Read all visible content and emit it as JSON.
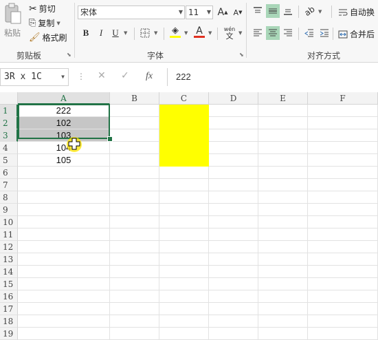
{
  "ribbon": {
    "clipboard": {
      "paste_label": "粘贴",
      "cut_label": "剪切",
      "copy_label": "复制",
      "format_painter_label": "格式刷",
      "group_label": "剪贴板"
    },
    "font": {
      "font_name": "宋体",
      "font_size": "11",
      "increase_label": "A",
      "decrease_label": "A",
      "bold": "B",
      "italic": "I",
      "underline": "U",
      "font_color_label": "A",
      "phonetic_top": "wén",
      "phonetic_bottom": "文",
      "group_label": "字体"
    },
    "alignment": {
      "wrap_label": "自动换",
      "merge_label": "合并后",
      "group_label": "对齐方式"
    }
  },
  "formula_bar": {
    "name_box": "3R x 1C",
    "fx": "fx",
    "value": "222"
  },
  "columns": [
    "A",
    "B",
    "C",
    "D",
    "E",
    "F"
  ],
  "rows": [
    "1",
    "2",
    "3",
    "4",
    "5",
    "6",
    "7",
    "8",
    "9",
    "10",
    "11",
    "12",
    "13",
    "14",
    "15",
    "16",
    "17",
    "18",
    "19"
  ],
  "cells": {
    "A1": "222",
    "A2": "102",
    "A3": "103",
    "A4": "104",
    "A5": "105"
  },
  "colors": {
    "accent": "#217346",
    "selection_gray": "#c6c6c6",
    "fill_yellow": "#ffff00",
    "align_active": "#a9d6b8"
  }
}
